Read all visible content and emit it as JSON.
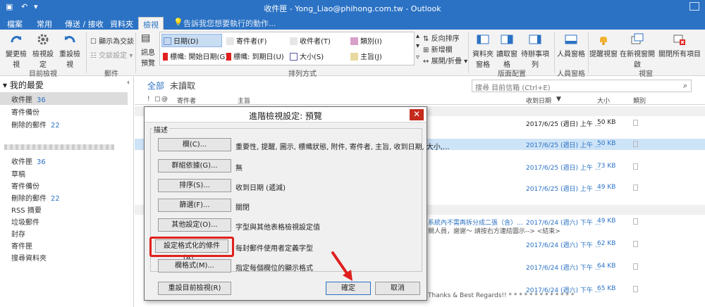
{
  "window": {
    "title": "收件匣 - Yong_Liao@phihong.com.tw - Outlook"
  },
  "tabs": [
    {
      "label": "檔案"
    },
    {
      "label": "常用"
    },
    {
      "label": "傳送 / 接收"
    },
    {
      "label": "資料夾"
    },
    {
      "label": "檢視"
    }
  ],
  "tell_me": "告訴我您想要執行的動作...",
  "ribbon": {
    "btn_change_view": "變更檢視",
    "btn_view_settings": "檢視設定",
    "btn_reset_view": "重設檢視",
    "show_as_conversation": "顯示為交談",
    "conversation_settings": "交談設定",
    "btn_message_preview": "訊息預覽",
    "gallery": [
      "日期(D)",
      "寄件者(F)",
      "收件者(T)",
      "類別(I)",
      "標幟: 開始日期(G)",
      "標幟: 到期日(U)",
      "大小(S)",
      "主旨(J)"
    ],
    "reverse_sort": "反向排序",
    "add_columns": "新增欄",
    "expand_collapse": "展開/折疊",
    "btn_folder_pane": "資料夾窗格",
    "btn_reading_pane": "讀取窗格",
    "btn_todo_bar": "待辦事項列",
    "btn_people_pane": "人員窗格",
    "btn_reminders": "提醒視窗",
    "btn_open_new_window": "在新視窗開啟",
    "btn_close_all": "關閉所有項目",
    "group_current_view": "目前檢視",
    "group_messages": "郵件",
    "group_arrangement": "排列方式",
    "group_layout": "版面配置",
    "group_people_pane": "人員窗格",
    "group_window": "視窗"
  },
  "nav": {
    "favorites_header": "我的最愛",
    "favorites": [
      {
        "label": "收件匣",
        "count": "36"
      },
      {
        "label": "寄件備份",
        "count": ""
      },
      {
        "label": "刪除的郵件",
        "count": "22"
      }
    ],
    "mailbox": [
      {
        "label": "收件匣",
        "count": "36"
      },
      {
        "label": "草稿",
        "count": ""
      },
      {
        "label": "寄件備份",
        "count": ""
      },
      {
        "label": "刪除的郵件",
        "count": "22"
      },
      {
        "label": "RSS 摘要",
        "count": ""
      },
      {
        "label": "垃圾郵件",
        "count": ""
      },
      {
        "label": "封存",
        "count": ""
      },
      {
        "label": "寄件匣",
        "count": ""
      },
      {
        "label": "搜尋資料夾",
        "count": ""
      }
    ]
  },
  "list": {
    "filter_all": "全部",
    "filter_unread": "未讀取",
    "search_placeholder": "搜尋 目前信箱 (Ctrl+E)",
    "col_from": "寄件者",
    "col_subject": "主旨",
    "col_received": "收到日期",
    "col_size": "大小",
    "col_category": "類別",
    "rows": [
      {
        "date": "2017/6/25 (週日) 上午 ...",
        "size": "50 KB",
        "blue": false
      },
      {
        "date": "2017/6/25 (週日) 上午 ...",
        "size": "50 KB",
        "blue": true
      },
      {
        "date": "2017/6/25 (週日) 上午 ...",
        "size": "73 KB",
        "blue": true
      },
      {
        "date": "2017/6/25 (週日) 上午 ...",
        "size": "49 KB",
        "blue": true
      },
      {
        "date": "2017/6/24 (週六) 下午 ...",
        "size": "49 KB",
        "blue": true
      },
      {
        "date": "2017/6/24 (週六) 下午 ...",
        "size": "62 KB",
        "blue": true
      },
      {
        "date": "2017/6/24 (週六) 下午 ...",
        "size": "64 KB",
        "blue": true
      },
      {
        "date": "2017/6/24 (週六) 下午 ...",
        "size": "65 KB",
        "blue": true
      }
    ],
    "snippet_1": "系統內不需再拆分成二張（含）...",
    "snippet_2": "關人員，謝謝～ 請按右方連結圖示--> <結束>",
    "snippet_3": "Thanks & Best Regards!! * * * * * * * * * * * * *"
  },
  "dialog": {
    "title": "進階檢視設定: 預覽",
    "group_label": "描述",
    "rows": [
      {
        "button": "欄(C)...",
        "desc": "重要性, 提醒, 圖示, 標幟狀態, 附件, 寄件者, 主旨, 收到日期, 大小,..."
      },
      {
        "button": "群組依據(G)...",
        "desc": "無"
      },
      {
        "button": "排序(S)...",
        "desc": "收到日期 (遞減)"
      },
      {
        "button": "篩選(F)...",
        "desc": "關閉"
      },
      {
        "button": "其他設定(O)...",
        "desc": "字型與其他表格檢視設定值"
      },
      {
        "button": "設定格式化的條件(A)...",
        "desc": "每封郵件使用者定義字型"
      },
      {
        "button": "欄格式(M)...",
        "desc": "指定每個欄位的顯示格式"
      }
    ],
    "reset_button": "重設目前檢視(R)",
    "ok_button": "確定",
    "cancel_button": "取消"
  },
  "colors": {
    "accent": "#2b72c4",
    "highlight_box": "#e0201e",
    "arrow": "#e0201e"
  }
}
